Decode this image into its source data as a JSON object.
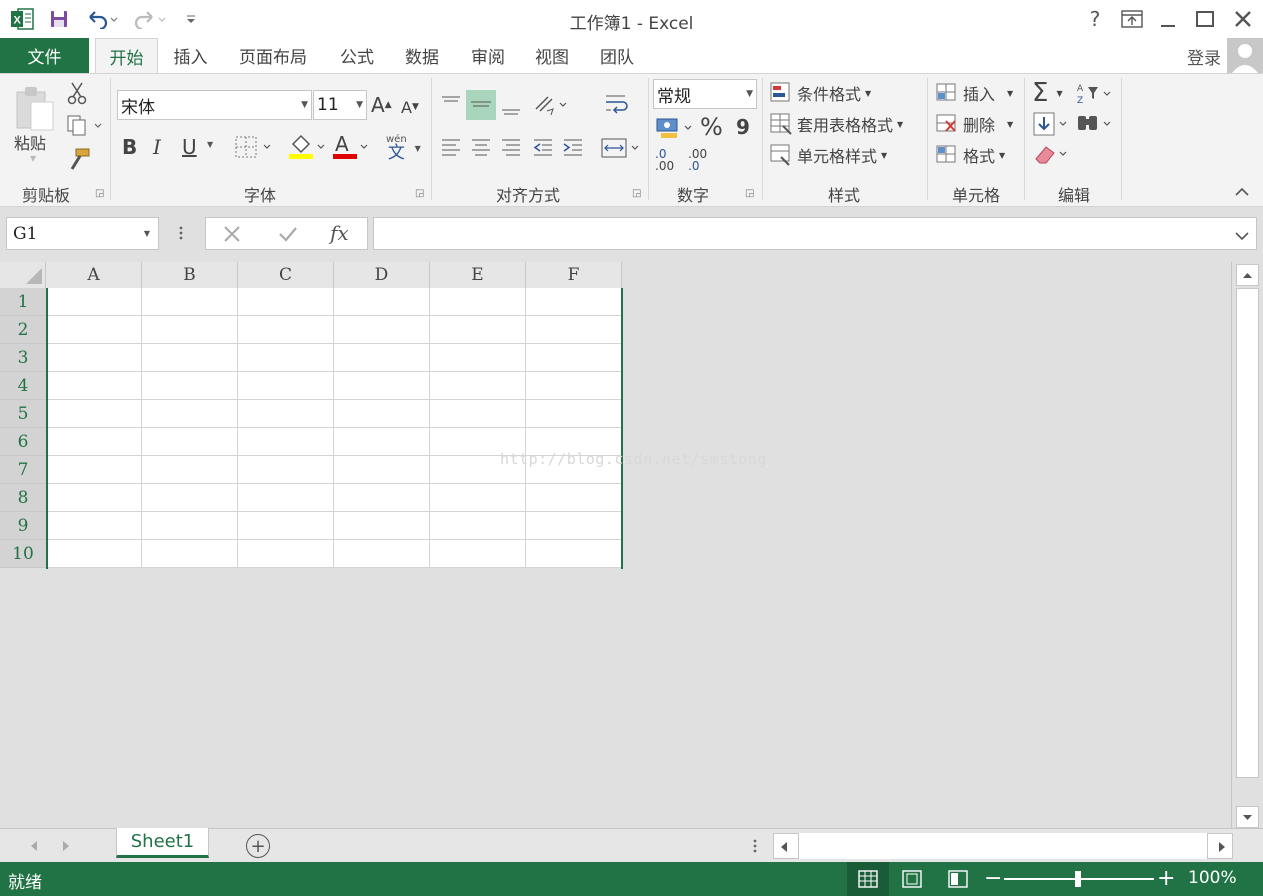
{
  "window": {
    "title": "工作簿1 - Excel",
    "help": "?",
    "sign_in": "登录"
  },
  "tabs": {
    "file": "文件",
    "items": [
      "开始",
      "插入",
      "页面布局",
      "公式",
      "数据",
      "审阅",
      "视图",
      "团队"
    ],
    "active": "开始"
  },
  "ribbon": {
    "clipboard": {
      "paste": "粘贴",
      "label": "剪贴板"
    },
    "font": {
      "name": "宋体",
      "size": "11",
      "bold": "B",
      "italic": "I",
      "underline": "U",
      "font_color_letter": "A",
      "phonetic_top": "wén",
      "phonetic_bottom": "文",
      "grow": "A",
      "shrink": "A",
      "label": "字体"
    },
    "alignment": {
      "label": "对齐方式"
    },
    "number": {
      "format": "常规",
      "percent": "%",
      "comma": "9",
      "inc_decimal": ".00",
      "dec_decimal": ".0",
      "label": "数字"
    },
    "styles": {
      "conditional": "条件格式",
      "table": "套用表格格式",
      "cell": "单元格样式",
      "label": "样式"
    },
    "cells": {
      "insert": "插入",
      "delete": "删除",
      "format": "格式",
      "label": "单元格"
    },
    "editing": {
      "sum": "Σ",
      "label": "编辑"
    }
  },
  "formula_bar": {
    "name_box": "G1",
    "fx": "fx",
    "content": ""
  },
  "sheet": {
    "columns": [
      "A",
      "B",
      "C",
      "D",
      "E",
      "F"
    ],
    "rows": [
      "1",
      "2",
      "3",
      "4",
      "5",
      "6",
      "7",
      "8",
      "9",
      "10"
    ],
    "watermark": "http://blog.csdn.net/smstong"
  },
  "sheet_tabs": {
    "active": "Sheet1",
    "add": "+"
  },
  "status_bar": {
    "ready": "就绪",
    "zoom": "100%"
  },
  "colors": {
    "accent": "#217346",
    "ribbon_bg": "#f3f3f3",
    "grid_bg": "#e0e0e0"
  }
}
